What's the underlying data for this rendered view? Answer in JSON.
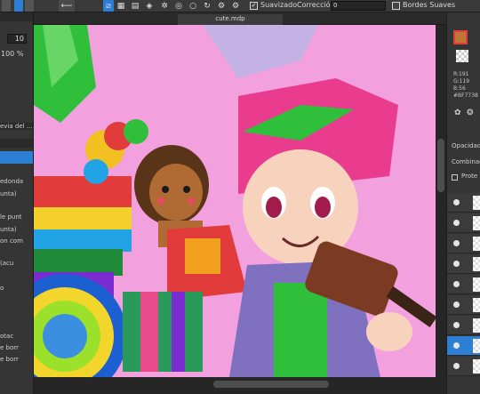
{
  "document": {
    "tab_title": "cute.mdp"
  },
  "toolbar": {
    "suavizado_label": "Suavizado",
    "suavizado_checked": "✓",
    "correccion_label": "Corrección",
    "correccion_value": "0",
    "bordes_label": "Bordes Suaves"
  },
  "left_panel": {
    "size_value": "10",
    "percent_value": "100 %",
    "preview_label": "evia del ...",
    "items": [
      "edonda",
      "unta)",
      "le punt",
      "unta)",
      "on com",
      "(acu",
      "o",
      "otac",
      "e borr",
      "e borr"
    ]
  },
  "right_panel": {
    "color_r": "R:191",
    "color_g": "G:119",
    "color_b": "B:56",
    "color_hex": "#BF7738",
    "opacidad_label": "Opacidad",
    "combinacion_label": "Combinació",
    "proteger_label": "Prote"
  },
  "colors": {
    "canvas_bg": "#f3a0df",
    "accent_blue": "#2d7fd3",
    "current_color": "#bf7738"
  }
}
